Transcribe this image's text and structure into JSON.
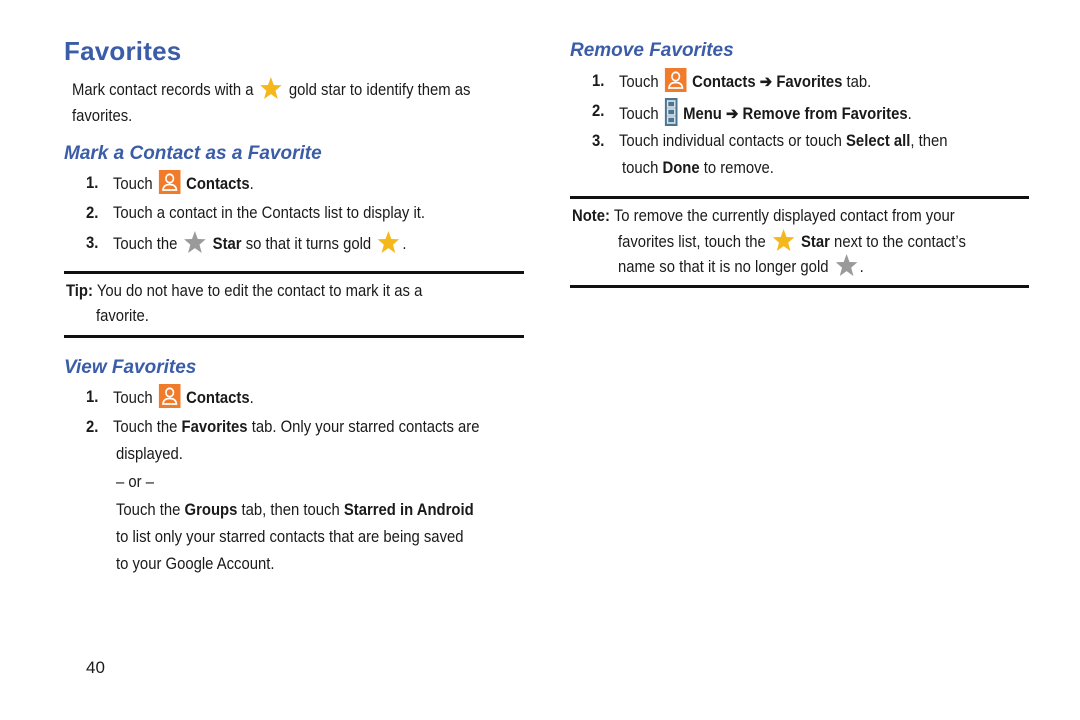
{
  "page_title": "Favorites",
  "intro": {
    "before_icon": "Mark contact records with a",
    "after_icon": "gold star to identify them as",
    "line2": "favorites."
  },
  "mark_section": {
    "heading": "Mark a Contact as a Favorite",
    "steps": [
      {
        "num": "1.",
        "pre": "Touch",
        "bold": "Contacts",
        "post": "."
      },
      {
        "num": "2.",
        "text": "Touch a contact in the Contacts list to display it."
      },
      {
        "num": "3.",
        "pre": "Touch the",
        "bold": "Star",
        "post": "so that it turns gold",
        "end": "."
      }
    ],
    "tip": {
      "label": "Tip:",
      "line1": "You do not have to edit the contact to mark it as a",
      "line2": "favorite."
    }
  },
  "view_section": {
    "heading": "View Favorites",
    "steps": [
      {
        "num": "1.",
        "pre": "Touch",
        "bold": "Contacts",
        "post": "."
      },
      {
        "num": "2.",
        "pre": "Touch the",
        "bold": "Favorites",
        "post": "tab. Only your starred contacts are",
        "line2": "displayed."
      }
    ],
    "or_text": "– or –",
    "alt": {
      "pre": "Touch the",
      "bold1": "Groups",
      "mid": "tab, then touch",
      "bold2": "Starred in Android",
      "line2": "to list only your starred contacts that are being saved",
      "line3": "to your Google Account."
    }
  },
  "remove_section": {
    "heading": "Remove Favorites",
    "steps": [
      {
        "num": "1.",
        "pre": "Touch",
        "bold": "Contacts ➔ Favorites",
        "post": "tab."
      },
      {
        "num": "2.",
        "pre": "Touch",
        "bold": "Menu ➔ Remove from Favorites",
        "post": "."
      },
      {
        "num": "3.",
        "pre": "Touch individual contacts or touch",
        "bold": "Select all",
        "post": ", then",
        "line2_pre": "touch",
        "line2_bold": "Done",
        "line2_post": "to remove."
      }
    ],
    "note": {
      "label": "Note:",
      "line1": "To remove the currently displayed contact from your",
      "line2_pre": "favorites list, touch the",
      "line2_bold": "Star",
      "line2_post": "next to the contact’s",
      "line3": "name so that it is no longer gold",
      "line3_end": "."
    }
  },
  "page_number": "40",
  "colors": {
    "heading_blue": "#3b5da8",
    "contacts_orange": "#f07b2a",
    "menu_slate": "#4c7590",
    "star_gold": "#f5b81c",
    "star_gray": "#9a9a9a"
  },
  "icons": {
    "contacts": "contacts-icon",
    "menu": "menu-icon",
    "gold_star": "gold-star-icon",
    "gray_star": "gray-star-icon"
  }
}
